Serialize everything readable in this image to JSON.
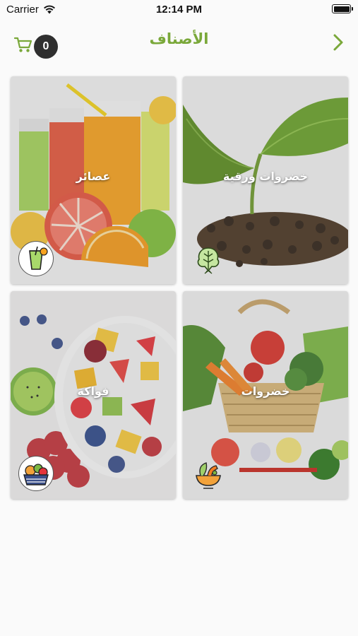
{
  "status_bar": {
    "carrier": "Carrier",
    "time": "12:14 PM"
  },
  "header": {
    "title": "الأصناف",
    "cart_count": "0"
  },
  "colors": {
    "accent": "#7aa83a",
    "badge": "#2f2f2f"
  },
  "categories": [
    {
      "label": "خضروات ورقية",
      "icon": "leafy-greens-icon"
    },
    {
      "label": "عصائر",
      "icon": "juice-glass-icon"
    },
    {
      "label": "خضروات",
      "icon": "vegetables-bowl-icon"
    },
    {
      "label": "فواكة",
      "icon": "fruit-basket-icon"
    }
  ]
}
